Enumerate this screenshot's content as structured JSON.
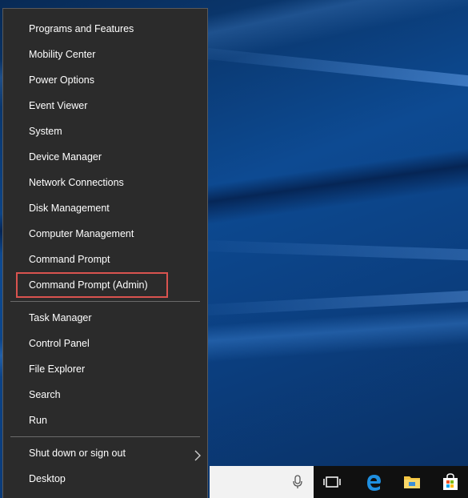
{
  "menu": {
    "group1": [
      {
        "label": "Programs and Features",
        "name": "menu-item-programs-and-features"
      },
      {
        "label": "Mobility Center",
        "name": "menu-item-mobility-center"
      },
      {
        "label": "Power Options",
        "name": "menu-item-power-options"
      },
      {
        "label": "Event Viewer",
        "name": "menu-item-event-viewer"
      },
      {
        "label": "System",
        "name": "menu-item-system"
      },
      {
        "label": "Device Manager",
        "name": "menu-item-device-manager"
      },
      {
        "label": "Network Connections",
        "name": "menu-item-network-connections"
      },
      {
        "label": "Disk Management",
        "name": "menu-item-disk-management"
      },
      {
        "label": "Computer Management",
        "name": "menu-item-computer-management"
      },
      {
        "label": "Command Prompt",
        "name": "menu-item-command-prompt"
      },
      {
        "label": "Command Prompt (Admin)",
        "name": "menu-item-command-prompt-admin"
      }
    ],
    "group2": [
      {
        "label": "Task Manager",
        "name": "menu-item-task-manager"
      },
      {
        "label": "Control Panel",
        "name": "menu-item-control-panel"
      },
      {
        "label": "File Explorer",
        "name": "menu-item-file-explorer"
      },
      {
        "label": "Search",
        "name": "menu-item-search"
      },
      {
        "label": "Run",
        "name": "menu-item-run"
      }
    ],
    "group3": [
      {
        "label": "Shut down or sign out",
        "name": "menu-item-shut-down-or-sign-out"
      },
      {
        "label": "Desktop",
        "name": "menu-item-desktop"
      }
    ]
  },
  "highlight_color": "#d9534f",
  "taskbar": {
    "icons": [
      "microphone-icon",
      "task-view-icon",
      "edge-icon",
      "file-explorer-icon",
      "store-icon"
    ]
  }
}
